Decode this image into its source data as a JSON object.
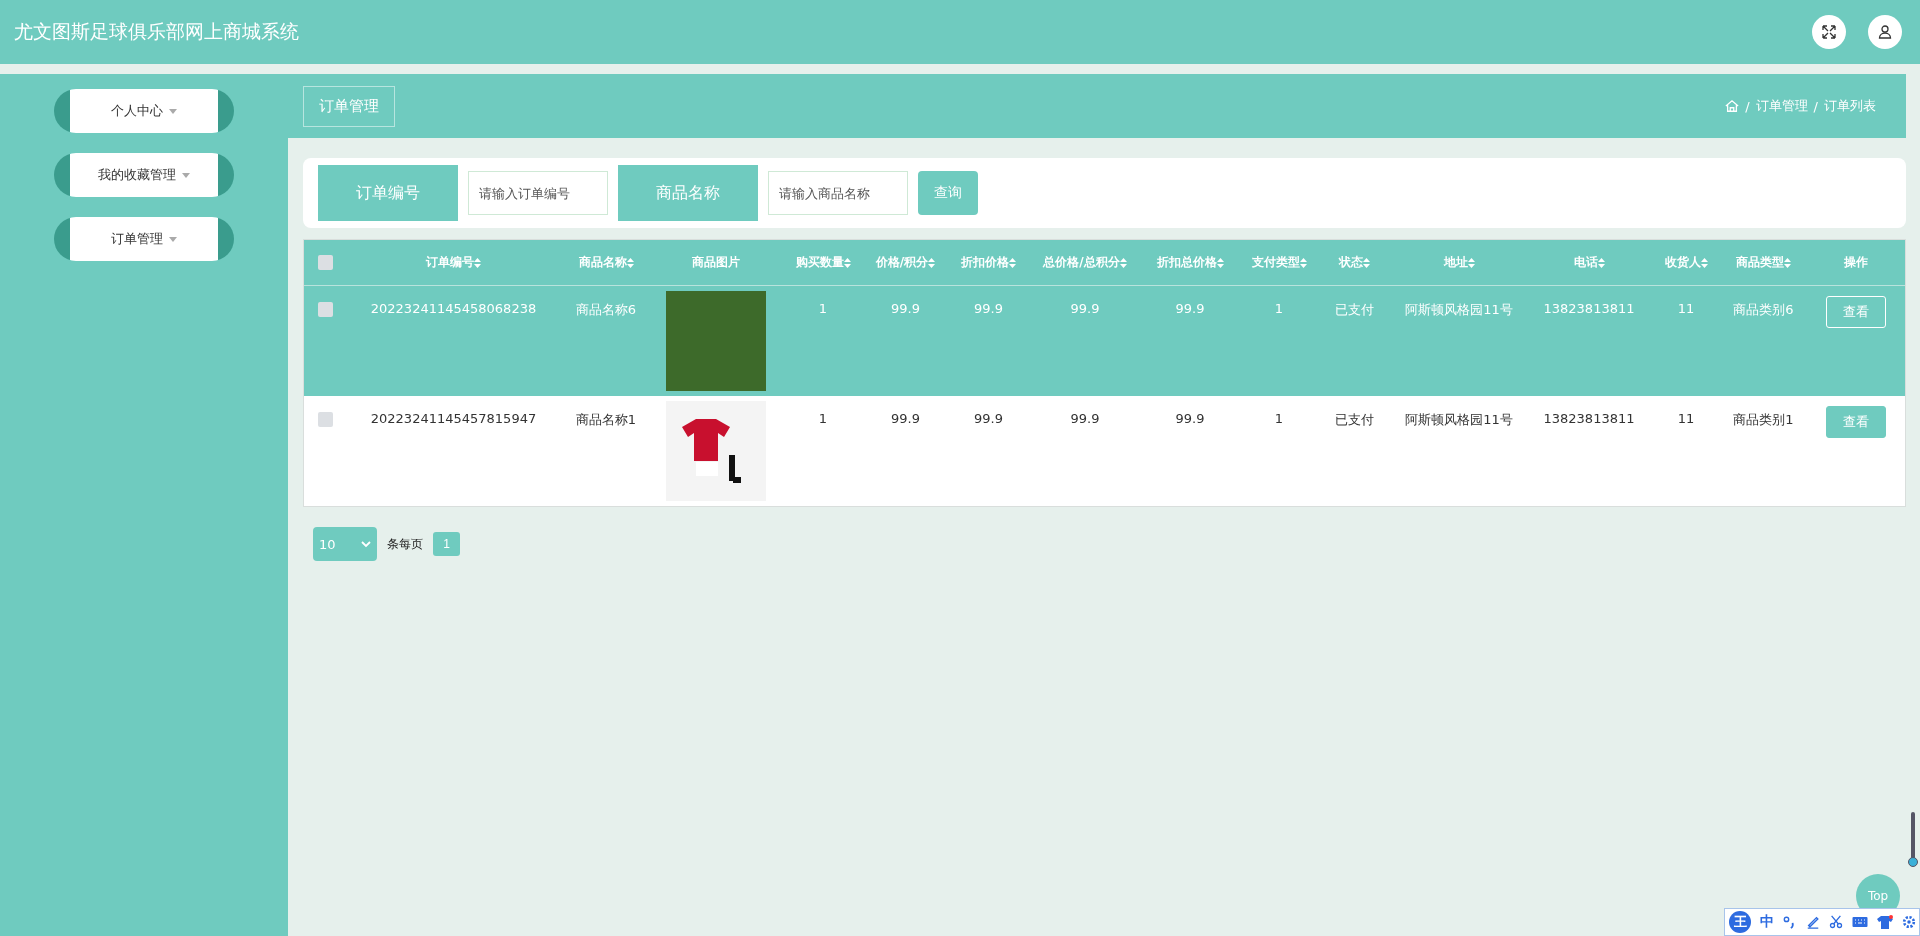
{
  "header": {
    "title": "尤文图斯足球俱乐部网上商城系统"
  },
  "sidebar": {
    "items": [
      {
        "label": "个人中心"
      },
      {
        "label": "我的收藏管理"
      },
      {
        "label": "订单管理"
      }
    ]
  },
  "page": {
    "title": "订单管理",
    "breadcrumb": [
      {
        "separator": "/",
        "label": "订单管理"
      },
      {
        "separator": "/",
        "label": "订单列表"
      }
    ]
  },
  "search": {
    "fields": [
      {
        "label": "订单编号",
        "placeholder": "请输入订单编号"
      },
      {
        "label": "商品名称",
        "placeholder": "请输入商品名称"
      }
    ],
    "button": "查询"
  },
  "table": {
    "header_checked": false,
    "columns": [
      {
        "label": "订单编号",
        "sortable": true,
        "kind": "text"
      },
      {
        "label": "商品名称",
        "sortable": true,
        "kind": "text"
      },
      {
        "label": "商品图片",
        "sortable": false,
        "kind": "image"
      },
      {
        "label": "购买数量",
        "sortable": true,
        "kind": "text"
      },
      {
        "label": "价格/积分",
        "sortable": true,
        "kind": "text"
      },
      {
        "label": "折扣价格",
        "sortable": true,
        "kind": "text"
      },
      {
        "label": "总价格/总积分",
        "sortable": true,
        "kind": "text"
      },
      {
        "label": "折扣总价格",
        "sortable": true,
        "kind": "text"
      },
      {
        "label": "支付类型",
        "sortable": true,
        "kind": "text"
      },
      {
        "label": "状态",
        "sortable": true,
        "kind": "text"
      },
      {
        "label": "地址",
        "sortable": true,
        "kind": "text"
      },
      {
        "label": "电话",
        "sortable": true,
        "kind": "text"
      },
      {
        "label": "收货人",
        "sortable": true,
        "kind": "text"
      },
      {
        "label": "商品类型",
        "sortable": true,
        "kind": "text"
      },
      {
        "label": "操作",
        "sortable": false,
        "kind": "action"
      }
    ],
    "rows": [
      {
        "selected": true,
        "checked": false,
        "cells": [
          "20223241145458068238",
          "商品名称6",
          "",
          "1",
          "99.9",
          "99.9",
          "99.9",
          "99.9",
          "1",
          "已支付",
          "阿斯顿风格园11号",
          "13823813811",
          "11",
          "商品类别6",
          "查看"
        ]
      },
      {
        "selected": false,
        "checked": false,
        "cells": [
          "20223241145457815947",
          "商品名称1",
          "",
          "1",
          "99.9",
          "99.9",
          "99.9",
          "99.9",
          "1",
          "已支付",
          "阿斯顿风格园11号",
          "13823813811",
          "11",
          "商品类别1",
          "查看"
        ]
      }
    ]
  },
  "pagination": {
    "page_size": "10",
    "label": "条每页",
    "pages": [
      {
        "label": "1",
        "selected": true
      }
    ]
  },
  "back_to_top": "Top",
  "ime_toolbar": {
    "logo": "王",
    "mode": "中"
  }
}
